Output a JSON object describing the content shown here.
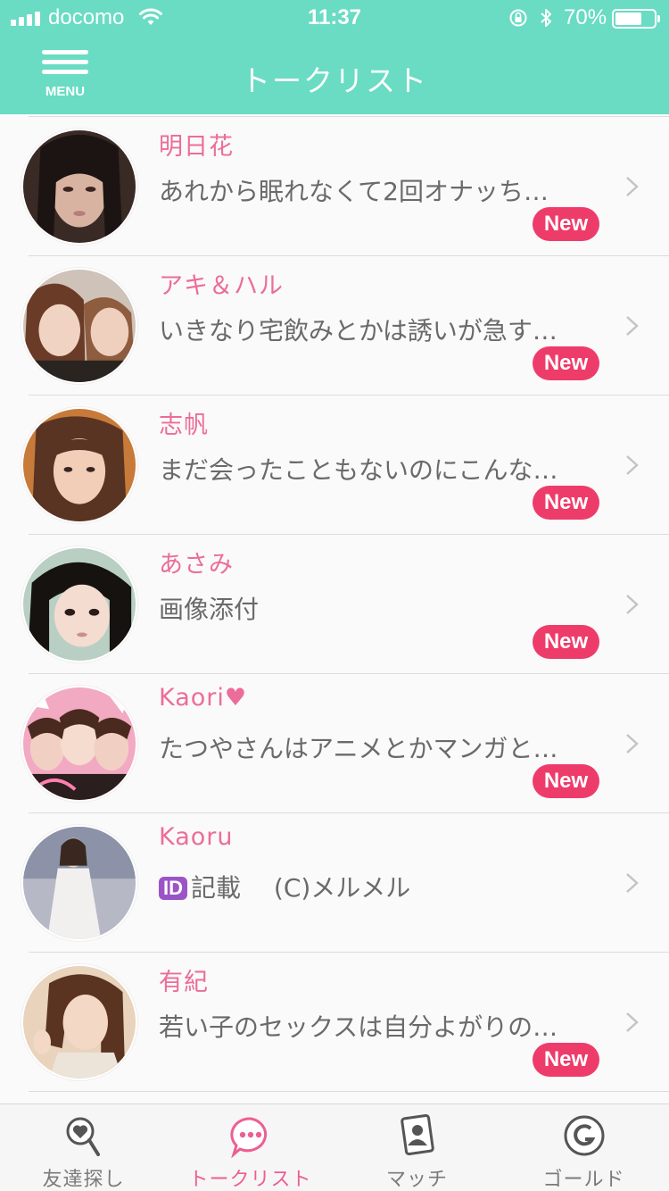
{
  "status_bar": {
    "carrier": "docomo",
    "time": "11:37",
    "battery": "70%",
    "battery_level": 0.7
  },
  "nav": {
    "menu_label": "MENU",
    "title": "トークリスト"
  },
  "conversations": [
    {
      "name": "明日花",
      "message": "あれから眠れなくて2回オナッち…",
      "badge": "New",
      "has_id_icon": false
    },
    {
      "name": "アキ＆ハル",
      "message": "いきなり宅飲みとかは誘いが急す…",
      "badge": "New",
      "has_id_icon": false
    },
    {
      "name": "志帆",
      "message": "まだ会ったこともないのにこんな…",
      "badge": "New",
      "has_id_icon": false
    },
    {
      "name": "あさみ",
      "message": "画像添付",
      "badge": "New",
      "has_id_icon": false
    },
    {
      "name": "Kaori♥",
      "message": "たつやさんはアニメとかマンガと…",
      "badge": "New",
      "has_id_icon": false
    },
    {
      "name": "Kaoru",
      "id_icon_label": "ID",
      "message": "記載 　(C)メルメル",
      "badge": "",
      "has_id_icon": true
    },
    {
      "name": "有紀",
      "message": "若い子のセックスは自分よがりの…",
      "badge": "New",
      "has_id_icon": false
    }
  ],
  "tabs": [
    {
      "label": "友達探し",
      "icon": "search-heart-icon",
      "active": false
    },
    {
      "label": "トークリスト",
      "icon": "chat-bubble-icon",
      "active": true
    },
    {
      "label": "マッチ",
      "icon": "profile-card-icon",
      "active": false
    },
    {
      "label": "ゴールド",
      "icon": "gold-coin-icon",
      "active": false
    }
  ],
  "colors": {
    "accent": "#69dcc3",
    "name_pink": "#ec6d99",
    "new_badge": "#ee3c6a",
    "tab_active": "#ec5f93"
  }
}
